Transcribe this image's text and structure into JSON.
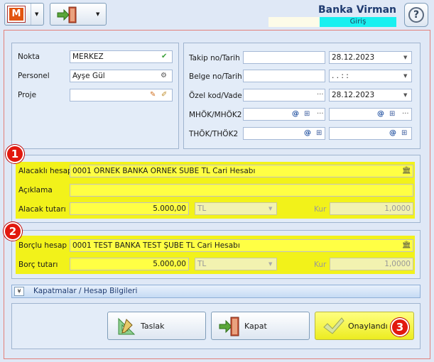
{
  "header": {
    "title": "Banka Virman",
    "subtitle": "Giriş"
  },
  "top": {
    "nokta_label": "Nokta",
    "nokta_value": "MERKEZ",
    "personel_label": "Personel",
    "personel_value": "Ayşe Gül",
    "proje_label": "Proje",
    "proje_value": "",
    "takip_label": "Takip no/Tarih",
    "takip_date": "28.12.2023",
    "belge_label": "Belge no/Tarih",
    "belge_date": ". .     : :",
    "ozel_label": "Özel kod/Vade",
    "ozel_date": "28.12.2023",
    "mhok_label": "MHÖK/MHÖK2",
    "thok_label": "THÖK/THÖK2"
  },
  "alacak": {
    "hesap_label": "Alacaklı hesap",
    "hesap_value": "0001 ORNEK BANKA ORNEK SUBE TL Cari Hesabı",
    "aciklama_label": "Açıklama",
    "aciklama_value": "",
    "tutar_label": "Alacak tutarı",
    "tutar_value": "5.000,00",
    "currency": "TL",
    "kur_label": "Kur",
    "kur_value": "1,0000"
  },
  "borc": {
    "hesap_label": "Borçlu hesap",
    "hesap_value": "0001 TEST BANKA TEST ŞUBE TL Cari Hesabı",
    "tutar_label": "Borç tutarı",
    "tutar_value": "5.000,00",
    "currency": "TL",
    "kur_label": "Kur",
    "kur_value": "1,0000"
  },
  "kapatmalar": {
    "label": "Kapatmalar / Hesap Bilgileri"
  },
  "buttons": {
    "taslak": "Taslak",
    "kapat": "Kapat",
    "onay": "Onaylandı"
  },
  "badges": {
    "b1": "1",
    "b2": "2",
    "b3": "3"
  },
  "icons": {
    "app": "M"
  }
}
